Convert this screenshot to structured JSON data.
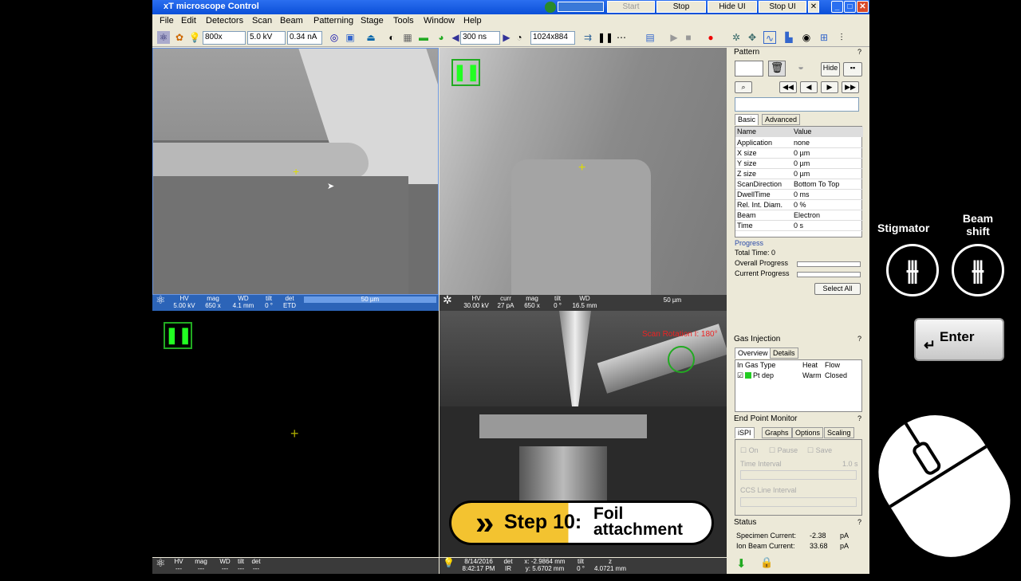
{
  "app": {
    "title": "xT microscope Control",
    "top_buttons": [
      "Start",
      "Stop",
      "Hide UI",
      "Stop UI"
    ]
  },
  "menu": [
    "File",
    "Edit",
    "Detectors",
    "Scan",
    "Beam",
    "Patterning",
    "Stage",
    "Tools",
    "Window",
    "Help"
  ],
  "toolbar": {
    "mag": "800x",
    "hv": "5.0 kV",
    "current": "0.34 nA",
    "dwell": "300 ns",
    "res": "1024x884"
  },
  "quad1": {
    "hv_l": "HV",
    "hv": "5.00 kV",
    "mag_l": "mag",
    "mag": "650 x",
    "wd_l": "WD",
    "wd": "4.1 mm",
    "tilt_l": "tilt",
    "tilt": "0 °",
    "det_l": "det",
    "det": "ETD",
    "scale": "50 µm"
  },
  "quad2": {
    "hv_l": "HV",
    "hv": "30.00 kV",
    "curr_l": "curr",
    "curr": "27 pA",
    "mag_l": "mag",
    "mag": "650 x",
    "tilt_l": "tilt",
    "tilt": "0 °",
    "wd_l": "WD",
    "wd": "16.5 mm",
    "scale": "50 µm"
  },
  "quad3": {
    "hv_l": "HV",
    "hv": "---",
    "mag_l": "mag",
    "mag": "---",
    "wd_l": "WD",
    "wd": "---",
    "tilt_l": "tilt",
    "tilt": "---",
    "det_l": "det",
    "det": "---"
  },
  "quad4": {
    "date": "8/14/2016",
    "time": "8:42:17 PM",
    "det_l": "det",
    "det": "IR",
    "x": "x: -2.9864 mm",
    "y": "y: 5.6702 mm",
    "tilt_l": "tilt",
    "tilt": "0 °",
    "z_l": "z",
    "z": "4.0721 mm",
    "overlay": "Scan Rotation I: 180°"
  },
  "banner": {
    "step": "Step 10:",
    "title_l1": "Foil",
    "title_l2": "attachment"
  },
  "pattern": {
    "title": "Pattern",
    "hide": "Hide",
    "tab_basic": "Basic",
    "tab_adv": "Advanced",
    "col_name": "Name",
    "col_value": "Value",
    "rows": [
      [
        "Application",
        "none"
      ],
      [
        "X size",
        "0 µm"
      ],
      [
        "Y size",
        "0 µm"
      ],
      [
        "Z size",
        "0 µm"
      ],
      [
        "ScanDirection",
        "Bottom To Top"
      ],
      [
        "DwellTime",
        "0 ms"
      ],
      [
        "Rel. Int. Diam.",
        "0 %"
      ],
      [
        "Beam",
        "Electron"
      ],
      [
        "Time",
        "0 s"
      ]
    ],
    "progress": "Progress",
    "total": "Total Time:  0",
    "overall": "Overall Progress",
    "current": "Current Progress",
    "select_all": "Select All"
  },
  "gas": {
    "title": "Gas Injection",
    "tab_overview": "Overview",
    "tab_details": "Details",
    "h1": "In Gas Type",
    "h2": "Heat",
    "h3": "Flow",
    "gas": "Pt dep",
    "heat": "Warm",
    "flow": "Closed"
  },
  "epm": {
    "title": "End Point Monitor",
    "tabs": [
      "iSPI",
      "Graphs",
      "Options",
      "Scaling"
    ],
    "on": "On",
    "pause": "Pause",
    "save": "Save",
    "time_interval": "Time Interval",
    "time_val": "1.0 s",
    "ccs": "CCS Line Interval"
  },
  "status": {
    "title": "Status",
    "spec_l": "Specimen Current:",
    "spec_v": "-2.38",
    "spec_u": "pA",
    "ion_l": "Ion Beam Current:",
    "ion_v": "33.68",
    "ion_u": "pA"
  },
  "overlay": {
    "stigmator": "Stigmator",
    "beam_l1": "Beam",
    "beam_l2": "shift",
    "enter": "Enter"
  }
}
